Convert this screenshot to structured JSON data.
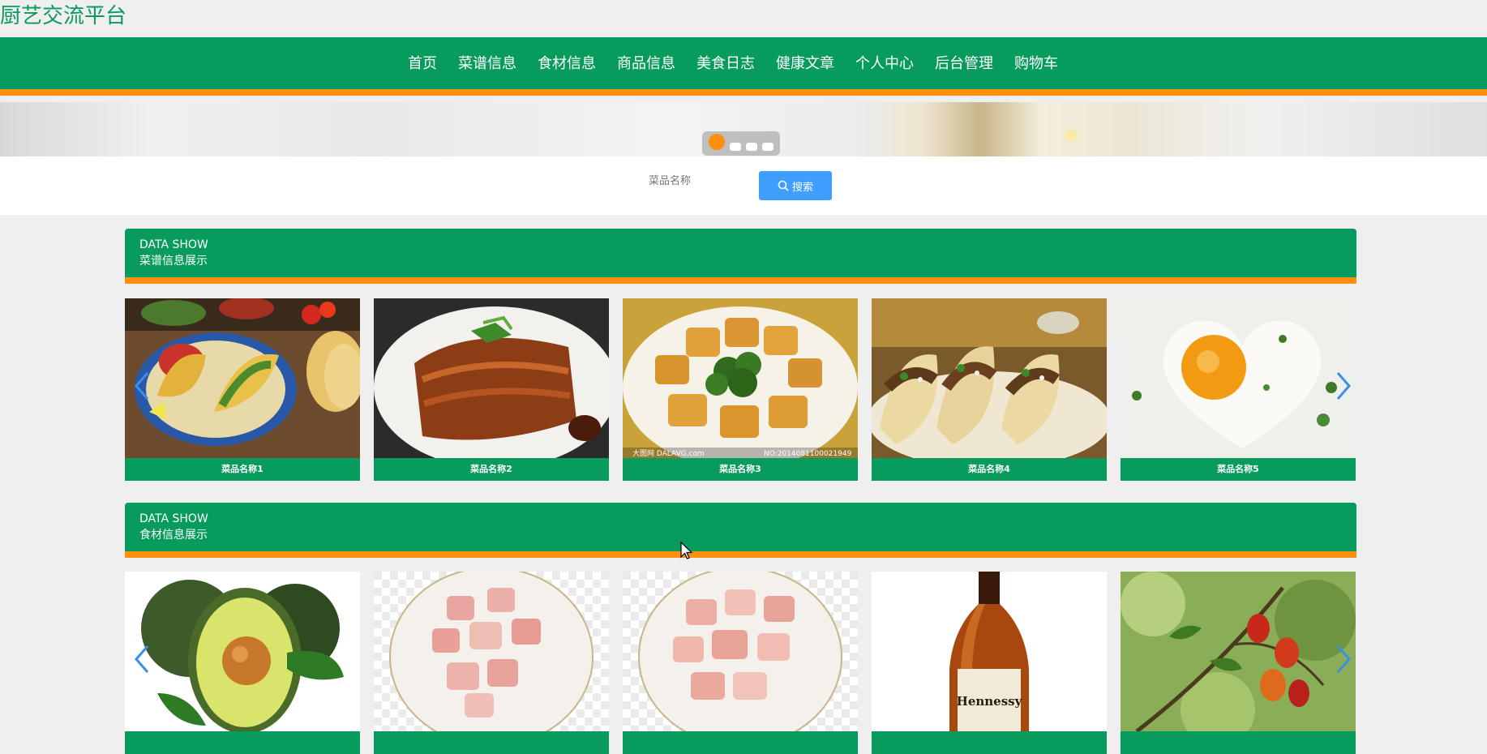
{
  "site": {
    "title": "厨艺交流平台"
  },
  "nav": {
    "items": [
      "首页",
      "菜谱信息",
      "食材信息",
      "商品信息",
      "美食日志",
      "健康文章",
      "个人中心",
      "后台管理",
      "购物车"
    ]
  },
  "search": {
    "placeholder": "菜品名称",
    "button_label": "搜索"
  },
  "sections": [
    {
      "en": "DATA SHOW",
      "cn": "菜谱信息展示",
      "cards": [
        {
          "label": "菜品名称1"
        },
        {
          "label": "菜品名称2"
        },
        {
          "label": "菜品名称3",
          "watermark_left": "大图网 DALAVG.com",
          "watermark_right": "NO:20140811000219​49"
        },
        {
          "label": "菜品名称4"
        },
        {
          "label": "菜品名称5"
        }
      ]
    },
    {
      "en": "DATA SHOW",
      "cn": "食材信息展示",
      "cards": [
        {
          "label": ""
        },
        {
          "label": ""
        },
        {
          "label": ""
        },
        {
          "label": "",
          "bottle_text": "Hennessy"
        },
        {
          "label": ""
        }
      ]
    }
  ],
  "colors": {
    "primary": "#079b5e",
    "accent": "#ff8f0e",
    "button": "#409eff",
    "title": "#0a9b5c"
  }
}
